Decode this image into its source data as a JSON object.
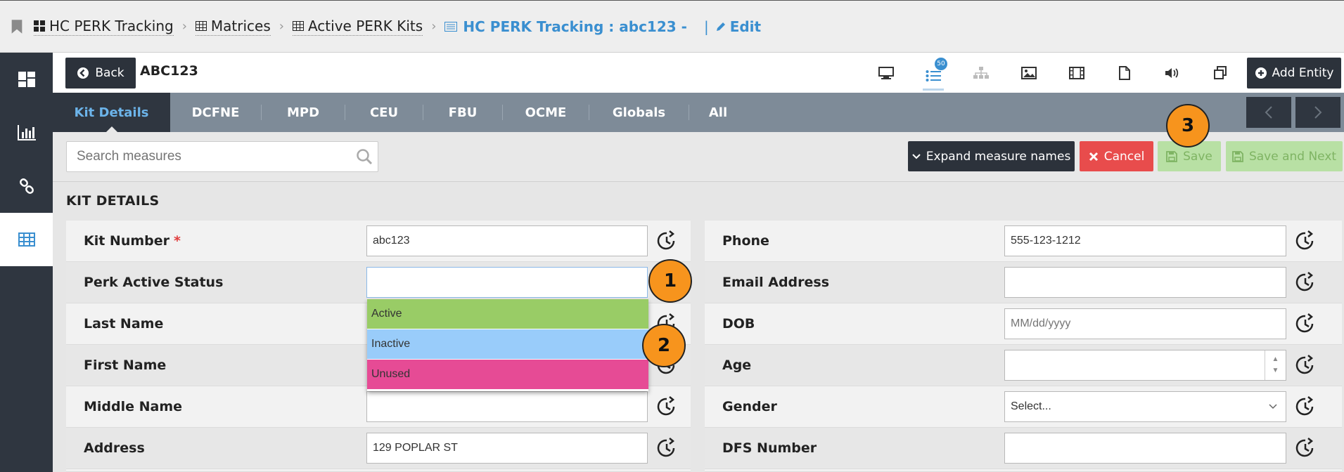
{
  "breadcrumb": {
    "items": [
      {
        "label": "HC PERK Tracking",
        "icon": "grid-icon"
      },
      {
        "label": "Matrices",
        "icon": "table-icon"
      },
      {
        "label": "Active PERK Kits",
        "icon": "table-icon"
      }
    ],
    "current": "HC PERK Tracking : abc123  -",
    "edit": "Edit"
  },
  "header": {
    "back_label": "Back",
    "entity_title": "ABC123",
    "badge_count": "50",
    "add_entity_label": "Add Entity"
  },
  "tabs": [
    {
      "label": "Kit Details",
      "active": true
    },
    {
      "label": "DCFNE"
    },
    {
      "label": "MPD"
    },
    {
      "label": "CEU"
    },
    {
      "label": "FBU"
    },
    {
      "label": "OCME"
    },
    {
      "label": "Globals"
    },
    {
      "label": "All"
    }
  ],
  "toolbar": {
    "search_placeholder": "Search measures",
    "expand_label": "Expand measure names",
    "cancel_label": "Cancel",
    "save_label": "Save",
    "save_next_label": "Save and Next"
  },
  "section": {
    "title": "KIT DETAILS",
    "left_fields": [
      {
        "label": "Kit Number",
        "required": "*",
        "value": "abc123",
        "placeholder": ""
      },
      {
        "label": "Perk Active Status",
        "value": "",
        "placeholder": ""
      },
      {
        "label": "Last Name",
        "value": "",
        "placeholder": ""
      },
      {
        "label": "First Name",
        "value": "",
        "placeholder": ""
      },
      {
        "label": "Middle Name",
        "value": "",
        "placeholder": ""
      },
      {
        "label": "Address",
        "value": "129 POPLAR ST",
        "placeholder": ""
      }
    ],
    "right_fields": [
      {
        "label": "Phone",
        "value": "555-123-1212",
        "placeholder": ""
      },
      {
        "label": "Email Address",
        "value": "",
        "placeholder": ""
      },
      {
        "label": "DOB",
        "value": "",
        "placeholder": "MM/dd/yyyy"
      },
      {
        "label": "Age",
        "value": "",
        "placeholder": ""
      },
      {
        "label": "Gender",
        "value": "Select...",
        "placeholder": ""
      },
      {
        "label": "DFS Number",
        "value": "",
        "placeholder": ""
      }
    ]
  },
  "dropdown": {
    "options": [
      {
        "label": "Active",
        "color": "#99cc66"
      },
      {
        "label": "Inactive",
        "color": "#99ccfa"
      },
      {
        "label": "Unused",
        "color": "#e64b95"
      }
    ]
  },
  "callouts": [
    "1",
    "2",
    "3"
  ],
  "colors": {
    "accent": "#3a8fd0",
    "dark": "#2c323b",
    "cancel": "#e84c4c",
    "save_disabled": "#b8e0a4",
    "callout": "#f7941d"
  }
}
